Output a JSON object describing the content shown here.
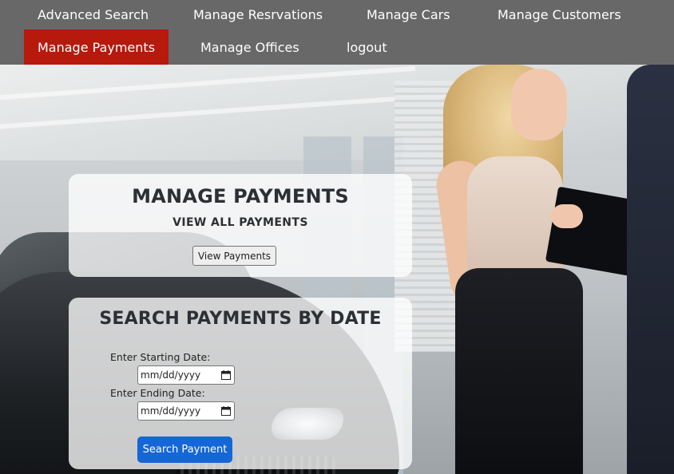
{
  "nav": {
    "items": [
      {
        "label": "Advanced Search"
      },
      {
        "label": "Manage Resrvations"
      },
      {
        "label": "Manage Cars"
      },
      {
        "label": "Manage Customers"
      },
      {
        "label": "Manage Payments",
        "active": true
      },
      {
        "label": "Manage Offices"
      },
      {
        "label": "logout"
      }
    ]
  },
  "manage_card": {
    "title": "MANAGE PAYMENTS",
    "subtitle": "VIEW ALL PAYMENTS",
    "button_label": "View Payments"
  },
  "search_card": {
    "title": "SEARCH PAYMENTS BY DATE",
    "start_label": "Enter Starting Date:",
    "start_value": "mm/dd/yyyy",
    "end_label": "Enter Ending Date:",
    "end_value": "mm/dd/yyyy",
    "button_label": "Search Payment"
  },
  "colors": {
    "nav_bg": "#686868",
    "nav_active": "#b7190d",
    "primary_button": "#1566d6"
  }
}
